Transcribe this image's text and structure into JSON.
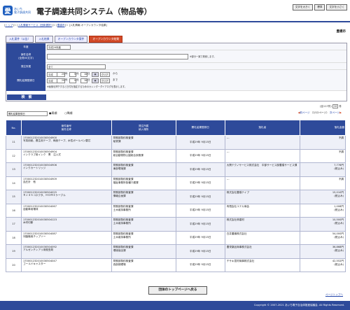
{
  "header": {
    "logo_mark": "愛",
    "logo_line1": "あいち",
    "logo_line2": "電子調達共同",
    "title": "電子調達共同システム（物品等）",
    "btn1": "文字を大きく",
    "btn2": "標準",
    "btn3": "文字を小さく"
  },
  "breadcrumb": {
    "items": [
      "トップ",
      "入札情報サービス（団体選択）",
      "豊橋市",
      "入札情報-オープンカウンタ結果"
    ]
  },
  "city": "豊橋市",
  "tabs": [
    "入札案件（公告）",
    "入札結果",
    "オープンカウンタ案件",
    "オープンカウンタ結果"
  ],
  "search": {
    "fiscal_label": "年度",
    "fiscal_value": "平成29年度",
    "case_label": "案件名称",
    "case_sub": "(全角50文字)",
    "case_note": "※部分一致で検索します。",
    "org_label": "発注所属",
    "org_value": "全て",
    "date_label": "開札結果登録日",
    "from_year": "平成",
    "from_y": "29",
    "from_m": "9",
    "from_d": "18",
    "to_y": "29",
    "to_m": "9",
    "to_d": "18",
    "unit_y": "年",
    "unit_m": "月",
    "unit_d": "日",
    "from_suffix": "から",
    "to_suffix": "まで",
    "clear": "クリア",
    "cal_note": "※画像を押下すると日付を指定するためのカレンダーダイアログを表示します。",
    "search_btn": "検　索"
  },
  "sort": {
    "select": "開札結果登録日",
    "asc": "昇順",
    "desc": "降順",
    "prev": "前ページ",
    "page": "（2/12ページ）",
    "next": "次ページ",
    "total": "(全117件)",
    "per_page": "10",
    "per_unit": "件"
  },
  "table": {
    "headers": {
      "no": "No.",
      "num": "案件番号",
      "num2": "案件名称",
      "org": "発注所属",
      "org2": "納入場所",
      "date": "開札結果登録日",
      "bidder": "落札者",
      "price": "落札金額"
    },
    "rows": [
      {
        "no": "11",
        "num": "170001232010030504900",
        "name": "写真用紙、養生用テープ、両面テープ、水性ボールペン替芯",
        "org": "財務部契約検査課",
        "place": "秘書課",
        "date": "平成29年 9月15日",
        "bidder": "---",
        "price": "不調",
        "tax": ""
      },
      {
        "no": "12",
        "num": "170001232010030504904",
        "name": "インクラブ用インク　黒　注入式",
        "org": "財務部契約検査課",
        "place": "総合動物物公園総合庶務課",
        "date": "平成29年 9月15日",
        "bidder": "---",
        "price": "不調",
        "tax": ""
      },
      {
        "no": "13",
        "num": "170001232010030504906",
        "name": "インクカートリッジ",
        "org": "財務部契約検査課",
        "place": "東部環境課",
        "date": "平成29年 9月15日",
        "bidder": "大興テクノサービス株式会社　中部サービス部豊橋サービス課",
        "price": "7,776円",
        "tax": "(税込み)"
      },
      {
        "no": "14",
        "num": "170001232010030504909",
        "name": "血圧計　他",
        "org": "財務部契約検査課",
        "place": "福祉事務所各種介護課",
        "date": "平成29年 9月15日",
        "bidder": "---",
        "price": "不調",
        "tax": ""
      },
      {
        "no": "15",
        "num": "170001232010030504025",
        "name": "ＲＪ４５コネクタ、ＨＤＭＩケーブル",
        "org": "財務部契約検査課",
        "place": "情報企画課",
        "date": "平成29年 9月15日",
        "bidder": "株式会社豊橋テイプ",
        "price": "15,010円",
        "tax": "(税込み)"
      },
      {
        "no": "16",
        "num": "170001232010030504067",
        "name": "自動車用電球",
        "org": "財務部契約検査課",
        "place": "土木維持事務所",
        "date": "平成29年 9月15日",
        "bidder": "有限会社ユテカ商会",
        "price": "1,008円",
        "tax": "(税込み)"
      },
      {
        "no": "17",
        "num": "170001232010030504123",
        "name": "木材切断",
        "org": "財務部契約検査課",
        "place": "土木維持事務所",
        "date": "平成29年 9月15日",
        "bidder": "株式会社林建材",
        "price": "10,500円",
        "tax": "(税込み)"
      },
      {
        "no": "18",
        "num": "170001232010030504087",
        "name": "河脇機用チップソー",
        "org": "財務部契約検査課",
        "place": "土木維持事務所",
        "date": "平成29年 9月15日",
        "bidder": "白井農機株式会社",
        "price": "54,000円",
        "tax": "(税込み)"
      },
      {
        "no": "19",
        "num": "170001232010030504092",
        "name": "アルゼンチンアリ用殺虫剤",
        "org": "財務部契約検査課",
        "place": "環境保全課",
        "date": "平成29年 9月15日",
        "bidder": "豊栄薬品商事株式会社",
        "price": "36,868円",
        "tax": "(税込み)"
      },
      {
        "no": "20",
        "num": "170001232010030504047",
        "name": "ゴールドキャスター",
        "org": "財務部契約検査課",
        "place": "西部調理場",
        "date": "平成29年 9月15日",
        "bidder": "チサキ混材商事株式会社",
        "price": "42,552円",
        "tax": "(税込み)"
      }
    ]
  },
  "topbtn": "団体のトップページへ戻る",
  "pagetop": "ページトップへ",
  "footer": "Copyright © 2007-2021 あいち電子自治体推進協議会. All Rights Reserved."
}
